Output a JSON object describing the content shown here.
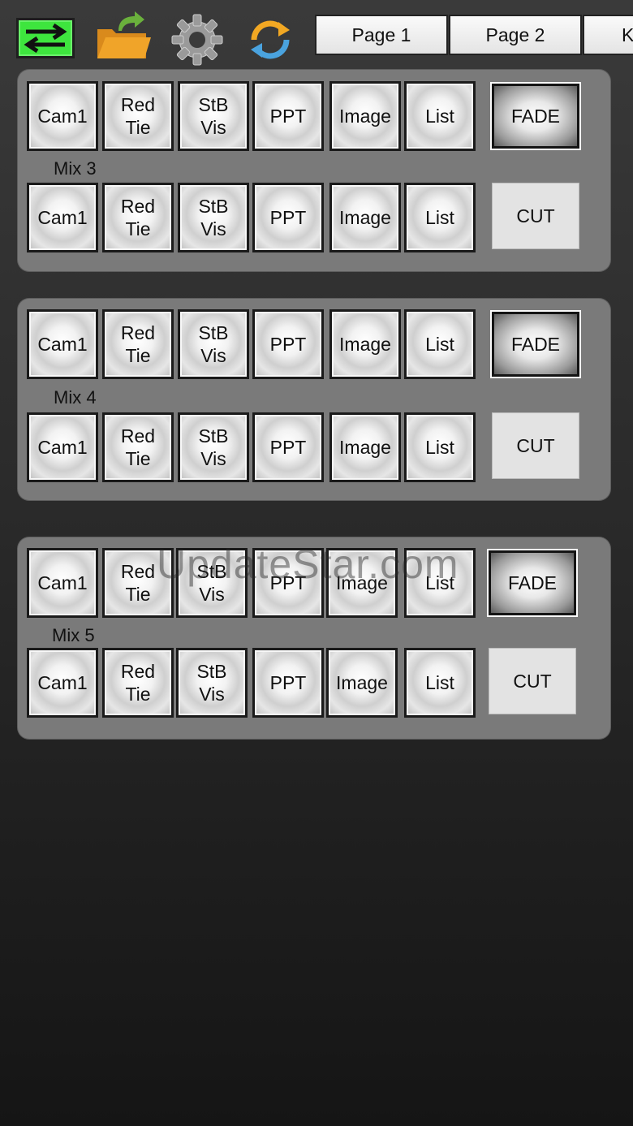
{
  "toolbar": {
    "tabs": [
      "Page 1",
      "Page 2",
      "K"
    ]
  },
  "colors": {
    "swap_button": "#3ee53e",
    "panel": "#7a7a7a",
    "folder": "#f0a429",
    "folder_arrow": "#6ab03c",
    "sync": "#f2a823",
    "sync_blue": "#4aa3df"
  },
  "icons": [
    "swap-arrows-icon",
    "folder-open-icon",
    "gear-icon",
    "sync-icon"
  ],
  "panels": [
    {
      "label": "Mix 3",
      "program_sources": [
        "Cam1",
        "Red\nTie",
        "StB\nVis",
        "PPT",
        "Image",
        "List"
      ],
      "preview_sources": [
        "Cam1",
        "Red\nTie",
        "StB\nVis",
        "PPT",
        "Image",
        "List"
      ],
      "fade": "FADE",
      "cut": "CUT"
    },
    {
      "label": "Mix 4",
      "program_sources": [
        "Cam1",
        "Red\nTie",
        "StB\nVis",
        "PPT",
        "Image",
        "List"
      ],
      "preview_sources": [
        "Cam1",
        "Red\nTie",
        "StB\nVis",
        "PPT",
        "Image",
        "List"
      ],
      "fade": "FADE",
      "cut": "CUT"
    },
    {
      "label": "Mix 5",
      "program_sources": [
        "Cam1",
        "Red\nTie",
        "StB\nVis",
        "PPT",
        "Image",
        "List"
      ],
      "preview_sources": [
        "Cam1",
        "Red\nTie",
        "StB\nVis",
        "PPT",
        "Image",
        "List"
      ],
      "fade": "FADE",
      "cut": "CUT"
    }
  ],
  "watermark": "UpdateStar.com"
}
